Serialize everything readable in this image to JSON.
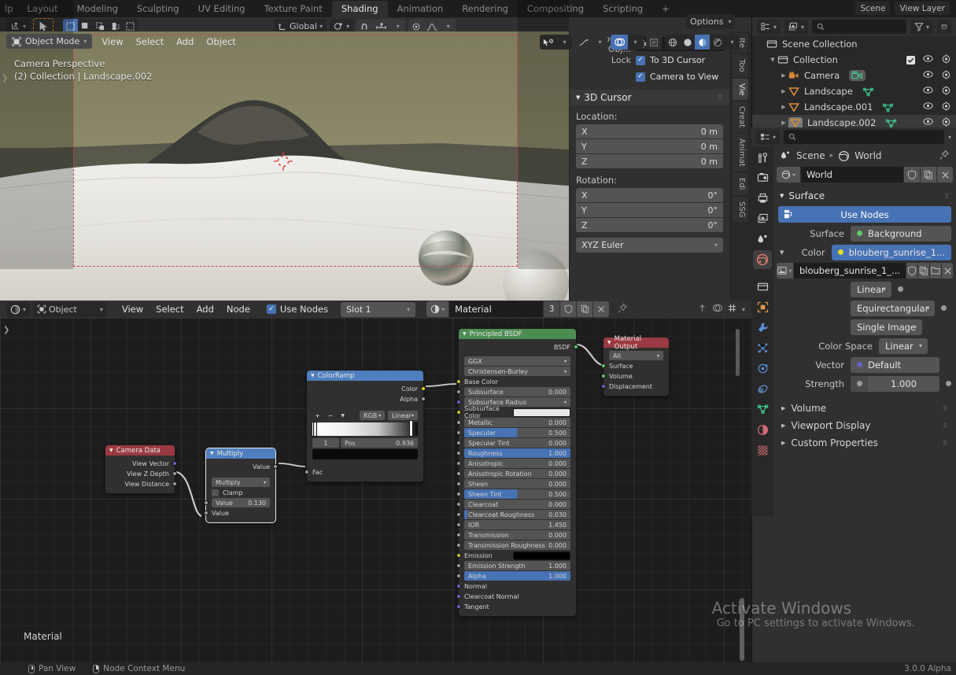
{
  "topbar": {
    "tabs": [
      {
        "label": "Layout",
        "active": false
      },
      {
        "label": "Modeling",
        "active": false
      },
      {
        "label": "Sculpting",
        "active": false
      },
      {
        "label": "UV Editing",
        "active": false
      },
      {
        "label": "Texture Paint",
        "active": false
      },
      {
        "label": "Shading",
        "active": true
      },
      {
        "label": "Animation",
        "active": false
      },
      {
        "label": "Rendering",
        "active": false
      },
      {
        "label": "Compositing",
        "active": false
      },
      {
        "label": "Scripting",
        "active": false
      },
      {
        "label": "+",
        "active": false
      }
    ],
    "left_clip": "lp",
    "scene_label": "Scene",
    "viewlayer_label": "View Layer"
  },
  "toolheader": {
    "transform_orientation": "Global",
    "options_label": "Options"
  },
  "viewport": {
    "mode": "Object Mode",
    "menus": [
      "View",
      "Select",
      "Add",
      "Object"
    ],
    "overlay_line1": "Camera Perspective",
    "overlay_line2": "(2) Collection | Landscape.002"
  },
  "npanel": {
    "lock_to_object_label": "Lock to Obj...",
    "lock_label": "Lock",
    "to_3d_cursor": "To 3D Cursor",
    "camera_to_view": "Camera to View",
    "to_3d_cursor_checked": true,
    "camera_to_view_checked": true,
    "cursor_title": "3D Cursor",
    "location_label": "Location:",
    "rotation_label": "Rotation:",
    "location": [
      {
        "axis": "X",
        "value": "0 m"
      },
      {
        "axis": "Y",
        "value": "0 m"
      },
      {
        "axis": "Z",
        "value": "0 m"
      }
    ],
    "rotation": [
      {
        "axis": "X",
        "value": "0°"
      },
      {
        "axis": "Y",
        "value": "0°"
      },
      {
        "axis": "Z",
        "value": "0°"
      }
    ],
    "euler_mode": "XYZ Euler",
    "tabs": [
      "Ite",
      "Too",
      "Vie",
      "Creat",
      "Animat",
      "Edi",
      "SSG"
    ],
    "active_tab": "Vie"
  },
  "outliner": {
    "search_placeholder": "",
    "rows": [
      {
        "label": "Scene Collection",
        "depth": 0,
        "icon": "collection-icon",
        "tri": "",
        "selected": false,
        "checkbox": false,
        "eye": false
      },
      {
        "label": "Collection",
        "depth": 1,
        "icon": "collection-icon",
        "tri": "▼",
        "selected": false,
        "checkbox": true,
        "eye": true
      },
      {
        "label": "Camera",
        "depth": 2,
        "icon": "camera-icon",
        "tri": "▶",
        "selected": false,
        "checkbox": false,
        "eye": true
      },
      {
        "label": "Landscape",
        "depth": 2,
        "icon": "mesh-icon",
        "tri": "▶",
        "selected": false,
        "checkbox": false,
        "eye": true
      },
      {
        "label": "Landscape.001",
        "depth": 2,
        "icon": "mesh-icon",
        "tri": "▶",
        "selected": false,
        "checkbox": false,
        "eye": true
      },
      {
        "label": "Landscape.002",
        "depth": 2,
        "icon": "mesh-icon",
        "tri": "▶",
        "selected": true,
        "checkbox": false,
        "eye": true
      }
    ]
  },
  "properties": {
    "search_placeholder": "",
    "breadcrumb_scene": "Scene",
    "breadcrumb_world": "World",
    "world_id_name": "World",
    "surface_section": "Surface",
    "use_nodes_label": "Use Nodes",
    "surface_label": "Surface",
    "surface_value": "Background",
    "color_label": "Color",
    "color_value": "blouberg_sunrise_1...",
    "image_id_name": "blouberg_sunrise_1_...",
    "interpolation": "Linear",
    "projection": "Equirectangular",
    "source": "Single Image",
    "colorspace_label": "Color Space",
    "colorspace_value": "Linear",
    "vector_label": "Vector",
    "vector_value": "Default",
    "strength_label": "Strength",
    "strength_value": "1.000",
    "collapsed_sections": [
      "Volume",
      "Viewport Display",
      "Custom Properties"
    ],
    "tab_icons": [
      "tool-icon",
      "render-icon",
      "output-icon",
      "viewlayer-icon",
      "scene-icon",
      "world-icon",
      "collection-icon",
      "object-icon",
      "modifier-icon",
      "particles-icon",
      "physics-icon",
      "constraint-icon",
      "data-icon",
      "material-icon",
      "texture-icon"
    ],
    "active_tab_index": 5
  },
  "shader_header": {
    "shader_type": "Object",
    "menus": [
      "View",
      "Select",
      "Add",
      "Node"
    ],
    "use_nodes_label": "Use Nodes",
    "use_nodes_checked": true,
    "slot": "Slot 1",
    "material_name": "Material",
    "material_users": "3"
  },
  "nodes": {
    "material_label": "Material",
    "camera_data": {
      "title": "Camera Data",
      "outputs": [
        "View Vector",
        "View Z Depth",
        "View Distance"
      ]
    },
    "multiply": {
      "title": "Multiply",
      "output_label": "Value",
      "operation": "Multiply",
      "clamp_label": "Clamp",
      "clamp_checked": false,
      "value_label": "Value",
      "value": "0.130",
      "input2_label": "Value"
    },
    "colorramp": {
      "title": "ColorRamp",
      "outputs": [
        "Color",
        "Alpha"
      ],
      "add_label": "+",
      "remove_label": "−",
      "color_mode": "RGB",
      "interpolation": "Linear",
      "index": "1",
      "pos_label": "Pos",
      "pos_value": "0.936",
      "input_label": "Fac"
    },
    "principled": {
      "title": "Principled BSDF",
      "output_label": "BSDF",
      "distribution": "GGX",
      "subsurface_method": "Christensen-Burley",
      "inputs": [
        {
          "label": "Base Color",
          "type": "color",
          "sock": "#c7c729",
          "value": ""
        },
        {
          "label": "Subsurface",
          "type": "slider",
          "sock": "#9a9a9a",
          "value": "0.000",
          "fill": "none"
        },
        {
          "label": "Subsurface Radius",
          "type": "dropdown",
          "sock": "#6363c7",
          "value": ""
        },
        {
          "label": "Subsurface Color",
          "type": "swatch",
          "sock": "#c7c729",
          "value": "",
          "swatch_color": "#e8e8e8"
        },
        {
          "label": "Metallic",
          "type": "slider",
          "sock": "#9a9a9a",
          "value": "0.000",
          "fill": "none"
        },
        {
          "label": "Specular",
          "type": "slider",
          "sock": "#9a9a9a",
          "value": "0.500",
          "fill": "half"
        },
        {
          "label": "Specular Tint",
          "type": "slider",
          "sock": "#9a9a9a",
          "value": "0.000",
          "fill": "none"
        },
        {
          "label": "Roughness",
          "type": "slider",
          "sock": "#9a9a9a",
          "value": "1.000",
          "fill": "full"
        },
        {
          "label": "Anisotropic",
          "type": "slider",
          "sock": "#9a9a9a",
          "value": "0.000",
          "fill": "none"
        },
        {
          "label": "Anisotropic Rotation",
          "type": "slider",
          "sock": "#9a9a9a",
          "value": "0.000",
          "fill": "none"
        },
        {
          "label": "Sheen",
          "type": "slider",
          "sock": "#9a9a9a",
          "value": "0.000",
          "fill": "none"
        },
        {
          "label": "Sheen Tint",
          "type": "slider",
          "sock": "#9a9a9a",
          "value": "0.500",
          "fill": "half"
        },
        {
          "label": "Clearcoat",
          "type": "slider",
          "sock": "#9a9a9a",
          "value": "0.000",
          "fill": "none"
        },
        {
          "label": "Clearcoat Roughness",
          "type": "slider",
          "sock": "#9a9a9a",
          "value": "0.030",
          "fill": "tiny"
        },
        {
          "label": "IOR",
          "type": "slider",
          "sock": "#9a9a9a",
          "value": "1.450",
          "fill": "none"
        },
        {
          "label": "Transmission",
          "type": "slider",
          "sock": "#9a9a9a",
          "value": "0.000",
          "fill": "none"
        },
        {
          "label": "Transmission Roughness",
          "type": "slider",
          "sock": "#9a9a9a",
          "value": "0.000",
          "fill": "none"
        },
        {
          "label": "Emission",
          "type": "swatch",
          "sock": "#c7c729",
          "value": "",
          "swatch_color": "#000000"
        },
        {
          "label": "Emission Strength",
          "type": "slider",
          "sock": "#9a9a9a",
          "value": "1.000",
          "fill": "none"
        },
        {
          "label": "Alpha",
          "type": "slider",
          "sock": "#9a9a9a",
          "value": "1.000",
          "fill": "full"
        },
        {
          "label": "Normal",
          "type": "plain",
          "sock": "#6363c7",
          "value": ""
        },
        {
          "label": "Clearcoat Normal",
          "type": "plain",
          "sock": "#6363c7",
          "value": ""
        },
        {
          "label": "Tangent",
          "type": "plain",
          "sock": "#6363c7",
          "value": ""
        }
      ]
    },
    "material_output": {
      "title": "Material Output",
      "target": "All",
      "inputs": [
        {
          "label": "Surface",
          "sock": "#5fc75f"
        },
        {
          "label": "Volume",
          "sock": "#5fc75f"
        },
        {
          "label": "Displacement",
          "sock": "#6363c7"
        }
      ]
    }
  },
  "watermark": {
    "title": "Activate Windows",
    "subtitle": "Go to PC settings to activate Windows."
  },
  "status": {
    "items": [
      {
        "icon": "mouse-middle-icon",
        "label": "Pan View"
      },
      {
        "icon": "mouse-right-icon",
        "label": "Node Context Menu"
      }
    ],
    "version": "3.0.0 Alpha"
  }
}
